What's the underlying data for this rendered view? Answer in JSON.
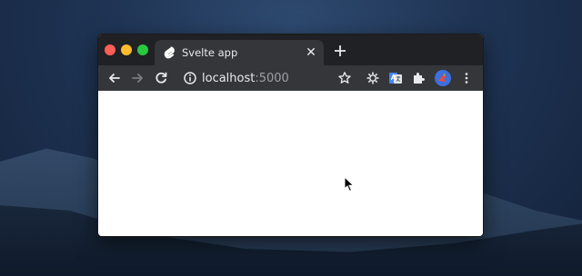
{
  "browser": {
    "tab": {
      "title": "Svelte app",
      "close_glyph": "✕"
    },
    "new_tab_icon": "plus-icon",
    "toolbar": {
      "back_icon": "arrow-left-icon",
      "forward_icon": "arrow-right-icon",
      "reload_icon": "reload-icon",
      "site_info_icon": "info-icon",
      "url_host": "localhost",
      "url_port": ":5000",
      "bookmark_icon": "star-icon",
      "extensions": [
        "gear-extension-icon",
        "translate-extension-icon",
        "puzzle-icon"
      ],
      "menu_icon": "kebab-menu-icon"
    }
  },
  "colors": {
    "tabbar_bg": "#202124",
    "toolbar_bg": "#35363a",
    "close_dot": "#ff5f57",
    "minimize_dot": "#febc2e",
    "maximize_dot": "#28c840",
    "avatar": "#3c6fe0"
  }
}
